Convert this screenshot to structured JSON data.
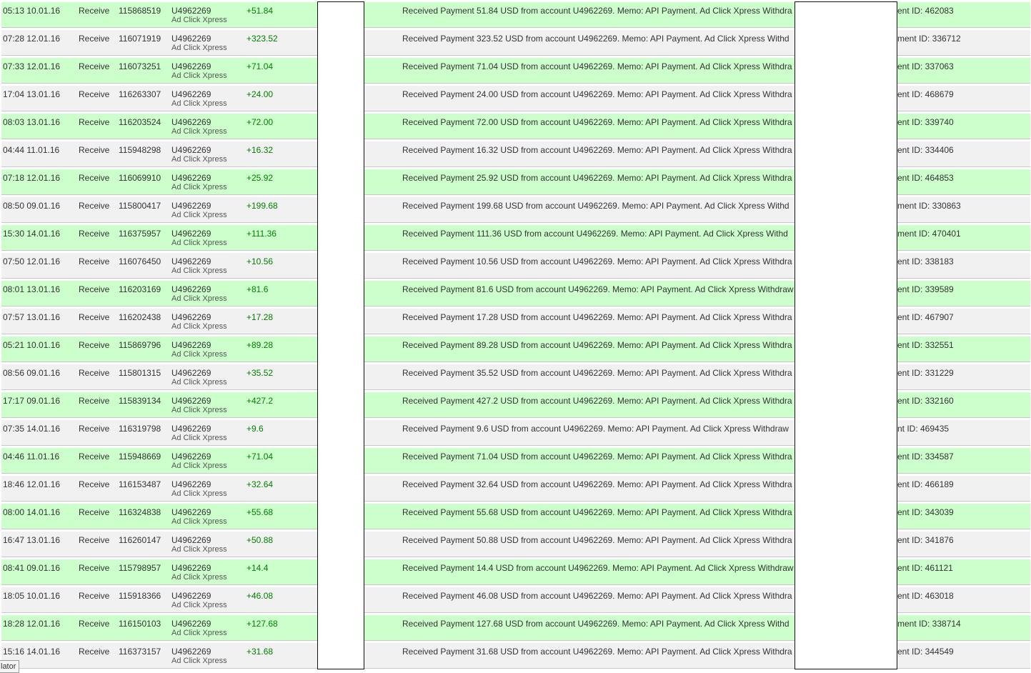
{
  "colors": {
    "credit_row": "#ccffcc",
    "alt_row": "#f1f1f1",
    "amount_text": "#008000"
  },
  "transactions": [
    {
      "time": "05:13 10.01.16",
      "type": "Receive",
      "batch": "115868519",
      "account": "U4962269",
      "name": "Ad Click Xpress",
      "amount": "+51.84",
      "memo_start": "Received Payment 51.84 USD from account U4962269. Memo: API Payment. Ad Click Xpress Withdra",
      "memo_end": "ent ID: 462083"
    },
    {
      "time": "07:28 12.01.16",
      "type": "Receive",
      "batch": "116071919",
      "account": "U4962269",
      "name": "Ad Click Xpress",
      "amount": "+323.52",
      "memo_start": "Received Payment 323.52 USD from account U4962269. Memo: API Payment. Ad Click Xpress Withd",
      "memo_end": "ment ID: 336712"
    },
    {
      "time": "07:33 12.01.16",
      "type": "Receive",
      "batch": "116073251",
      "account": "U4962269",
      "name": "Ad Click Xpress",
      "amount": "+71.04",
      "memo_start": "Received Payment 71.04 USD from account U4962269. Memo: API Payment. Ad Click Xpress Withdra",
      "memo_end": "ent ID: 337063"
    },
    {
      "time": "17:04 13.01.16",
      "type": "Receive",
      "batch": "116263307",
      "account": "U4962269",
      "name": "Ad Click Xpress",
      "amount": "+24.00",
      "memo_start": "Received Payment 24.00 USD from account U4962269. Memo: API Payment. Ad Click Xpress Withdra",
      "memo_end": "ent ID: 468679"
    },
    {
      "time": "08:03 13.01.16",
      "type": "Receive",
      "batch": "116203524",
      "account": "U4962269",
      "name": "Ad Click Xpress",
      "amount": "+72.00",
      "memo_start": "Received Payment 72.00 USD from account U4962269. Memo: API Payment. Ad Click Xpress Withdra",
      "memo_end": "ent ID: 339740"
    },
    {
      "time": "04:44 11.01.16",
      "type": "Receive",
      "batch": "115948298",
      "account": "U4962269",
      "name": "Ad Click Xpress",
      "amount": "+16.32",
      "memo_start": "Received Payment 16.32 USD from account U4962269. Memo: API Payment. Ad Click Xpress Withdra",
      "memo_end": "ent ID: 334406"
    },
    {
      "time": "07:18 12.01.16",
      "type": "Receive",
      "batch": "116069910",
      "account": "U4962269",
      "name": "Ad Click Xpress",
      "amount": "+25.92",
      "memo_start": "Received Payment 25.92 USD from account U4962269. Memo: API Payment. Ad Click Xpress Withdra",
      "memo_end": "ent ID: 464853"
    },
    {
      "time": "08:50 09.01.16",
      "type": "Receive",
      "batch": "115800417",
      "account": "U4962269",
      "name": "Ad Click Xpress",
      "amount": "+199.68",
      "memo_start": "Received Payment 199.68 USD from account U4962269. Memo: API Payment. Ad Click Xpress Withd",
      "memo_end": "ment ID: 330863"
    },
    {
      "time": "15:30 14.01.16",
      "type": "Receive",
      "batch": "116375957",
      "account": "U4962269",
      "name": "Ad Click Xpress",
      "amount": "+111.36",
      "memo_start": "Received Payment 111.36 USD from account U4962269. Memo: API Payment. Ad Click Xpress Withd",
      "memo_end": "ment ID: 470401"
    },
    {
      "time": "07:50 12.01.16",
      "type": "Receive",
      "batch": "116076450",
      "account": "U4962269",
      "name": "Ad Click Xpress",
      "amount": "+10.56",
      "memo_start": "Received Payment 10.56 USD from account U4962269. Memo: API Payment. Ad Click Xpress Withdra",
      "memo_end": "ent ID: 338183"
    },
    {
      "time": "08:01 13.01.16",
      "type": "Receive",
      "batch": "116203169",
      "account": "U4962269",
      "name": "Ad Click Xpress",
      "amount": "+81.6",
      "memo_start": "Received Payment 81.6 USD from account U4962269. Memo: API Payment. Ad Click Xpress Withdraw",
      "memo_end": "ent ID: 339589"
    },
    {
      "time": "07:57 13.01.16",
      "type": "Receive",
      "batch": "116202438",
      "account": "U4962269",
      "name": "Ad Click Xpress",
      "amount": "+17.28",
      "memo_start": "Received Payment 17.28 USD from account U4962269. Memo: API Payment. Ad Click Xpress Withdra",
      "memo_end": "ent ID: 467907"
    },
    {
      "time": "05:21 10.01.16",
      "type": "Receive",
      "batch": "115869796",
      "account": "U4962269",
      "name": "Ad Click Xpress",
      "amount": "+89.28",
      "memo_start": "Received Payment 89.28 USD from account U4962269. Memo: API Payment. Ad Click Xpress Withdra",
      "memo_end": "ent ID: 332551"
    },
    {
      "time": "08:56 09.01.16",
      "type": "Receive",
      "batch": "115801315",
      "account": "U4962269",
      "name": "Ad Click Xpress",
      "amount": "+35.52",
      "memo_start": "Received Payment 35.52 USD from account U4962269. Memo: API Payment. Ad Click Xpress Withdra",
      "memo_end": "ent ID: 331229"
    },
    {
      "time": "17:17 09.01.16",
      "type": "Receive",
      "batch": "115839134",
      "account": "U4962269",
      "name": "Ad Click Xpress",
      "amount": "+427.2",
      "memo_start": "Received Payment 427.2 USD from account U4962269. Memo: API Payment. Ad Click Xpress Withdra",
      "memo_end": "ent ID: 332160"
    },
    {
      "time": "07:35 14.01.16",
      "type": "Receive",
      "batch": "116319798",
      "account": "U4962269",
      "name": "Ad Click Xpress",
      "amount": "+9.6",
      "memo_start": "Received Payment 9.6 USD from account U4962269. Memo: API Payment. Ad Click Xpress Withdraw",
      "memo_end": "nt ID: 469435"
    },
    {
      "time": "04:46 11.01.16",
      "type": "Receive",
      "batch": "115948669",
      "account": "U4962269",
      "name": "Ad Click Xpress",
      "amount": "+71.04",
      "memo_start": "Received Payment 71.04 USD from account U4962269. Memo: API Payment. Ad Click Xpress Withdra",
      "memo_end": "ent ID: 334587"
    },
    {
      "time": "18:46 12.01.16",
      "type": "Receive",
      "batch": "116153487",
      "account": "U4962269",
      "name": "Ad Click Xpress",
      "amount": "+32.64",
      "memo_start": "Received Payment 32.64 USD from account U4962269. Memo: API Payment. Ad Click Xpress Withdra",
      "memo_end": "ent ID: 466189"
    },
    {
      "time": "08:00 14.01.16",
      "type": "Receive",
      "batch": "116324838",
      "account": "U4962269",
      "name": "Ad Click Xpress",
      "amount": "+55.68",
      "memo_start": "Received Payment 55.68 USD from account U4962269. Memo: API Payment. Ad Click Xpress Withdra",
      "memo_end": "ent ID: 343039"
    },
    {
      "time": "16:47 13.01.16",
      "type": "Receive",
      "batch": "116260147",
      "account": "U4962269",
      "name": "Ad Click Xpress",
      "amount": "+50.88",
      "memo_start": "Received Payment 50.88 USD from account U4962269. Memo: API Payment. Ad Click Xpress Withdra",
      "memo_end": "ent ID: 341876"
    },
    {
      "time": "08:41 09.01.16",
      "type": "Receive",
      "batch": "115798957",
      "account": "U4962269",
      "name": "Ad Click Xpress",
      "amount": "+14.4",
      "memo_start": "Received Payment 14.4 USD from account U4962269. Memo: API Payment. Ad Click Xpress Withdraw",
      "memo_end": "ent ID: 461121"
    },
    {
      "time": "18:05 10.01.16",
      "type": "Receive",
      "batch": "115918366",
      "account": "U4962269",
      "name": "Ad Click Xpress",
      "amount": "+46.08",
      "memo_start": "Received Payment 46.08 USD from account U4962269. Memo: API Payment. Ad Click Xpress Withdra",
      "memo_end": "ent ID: 463018"
    },
    {
      "time": "18:28 12.01.16",
      "type": "Receive",
      "batch": "116150103",
      "account": "U4962269",
      "name": "Ad Click Xpress",
      "amount": "+127.68",
      "memo_start": "Received Payment 127.68 USD from account U4962269. Memo: API Payment. Ad Click Xpress Withd",
      "memo_end": "ment ID: 338714"
    },
    {
      "time": "15:16 14.01.16",
      "type": "Receive",
      "batch": "116373157",
      "account": "U4962269",
      "name": "Ad Click Xpress",
      "amount": "+31.68",
      "memo_start": "Received Payment 31.68 USD from account U4962269. Memo: API Payment. Ad Click Xpress Withdra",
      "memo_end": "ent ID: 344549"
    }
  ],
  "status_tab": "lator"
}
